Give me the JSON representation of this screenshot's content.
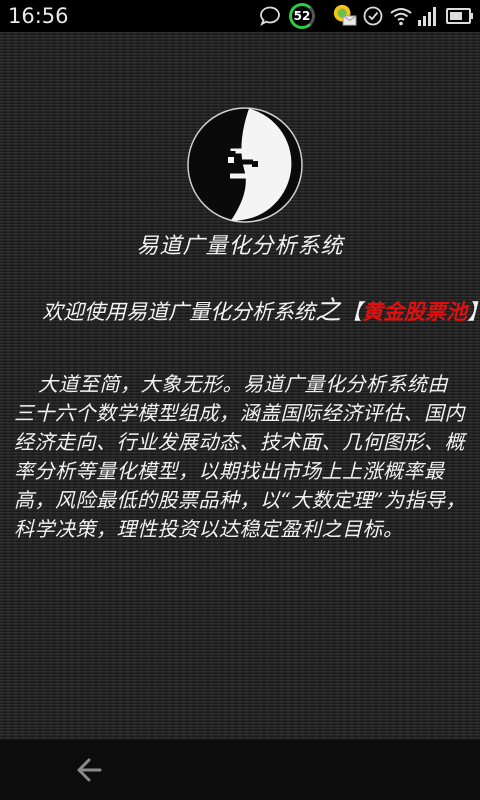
{
  "status_bar": {
    "time": "16:56",
    "battery_percent": "52",
    "icons": [
      "chat-bubble-icon",
      "battery-circle-icon",
      "app-notification-icon",
      "check-circle-icon",
      "wifi-icon",
      "signal-bars-icon",
      "battery-icon"
    ],
    "accent_color": "#2ecc40"
  },
  "app": {
    "title": "易道广量化分析系统",
    "welcome_prefix": "欢迎使用易道广量化分析系统",
    "welcome_zhi": "之",
    "bracket_open": "【",
    "welcome_highlight": "黄金股票池",
    "bracket_close": "】",
    "highlight_color": "#e01010",
    "description": "大道至简，大象无形。易道广量化分析系统由三十六个数学模型组成，涵盖国际经济评估、国内经济走向、行业发展动态、技术面、几何图形、概率分析等量化模型，以期找出市场上上涨概率最高，风险最低的股票品种，以“大数定理”为指导，科学决策，理性投资以达稳定盈利之目标。"
  },
  "nav": {
    "back_icon": "back-arrow-icon"
  }
}
